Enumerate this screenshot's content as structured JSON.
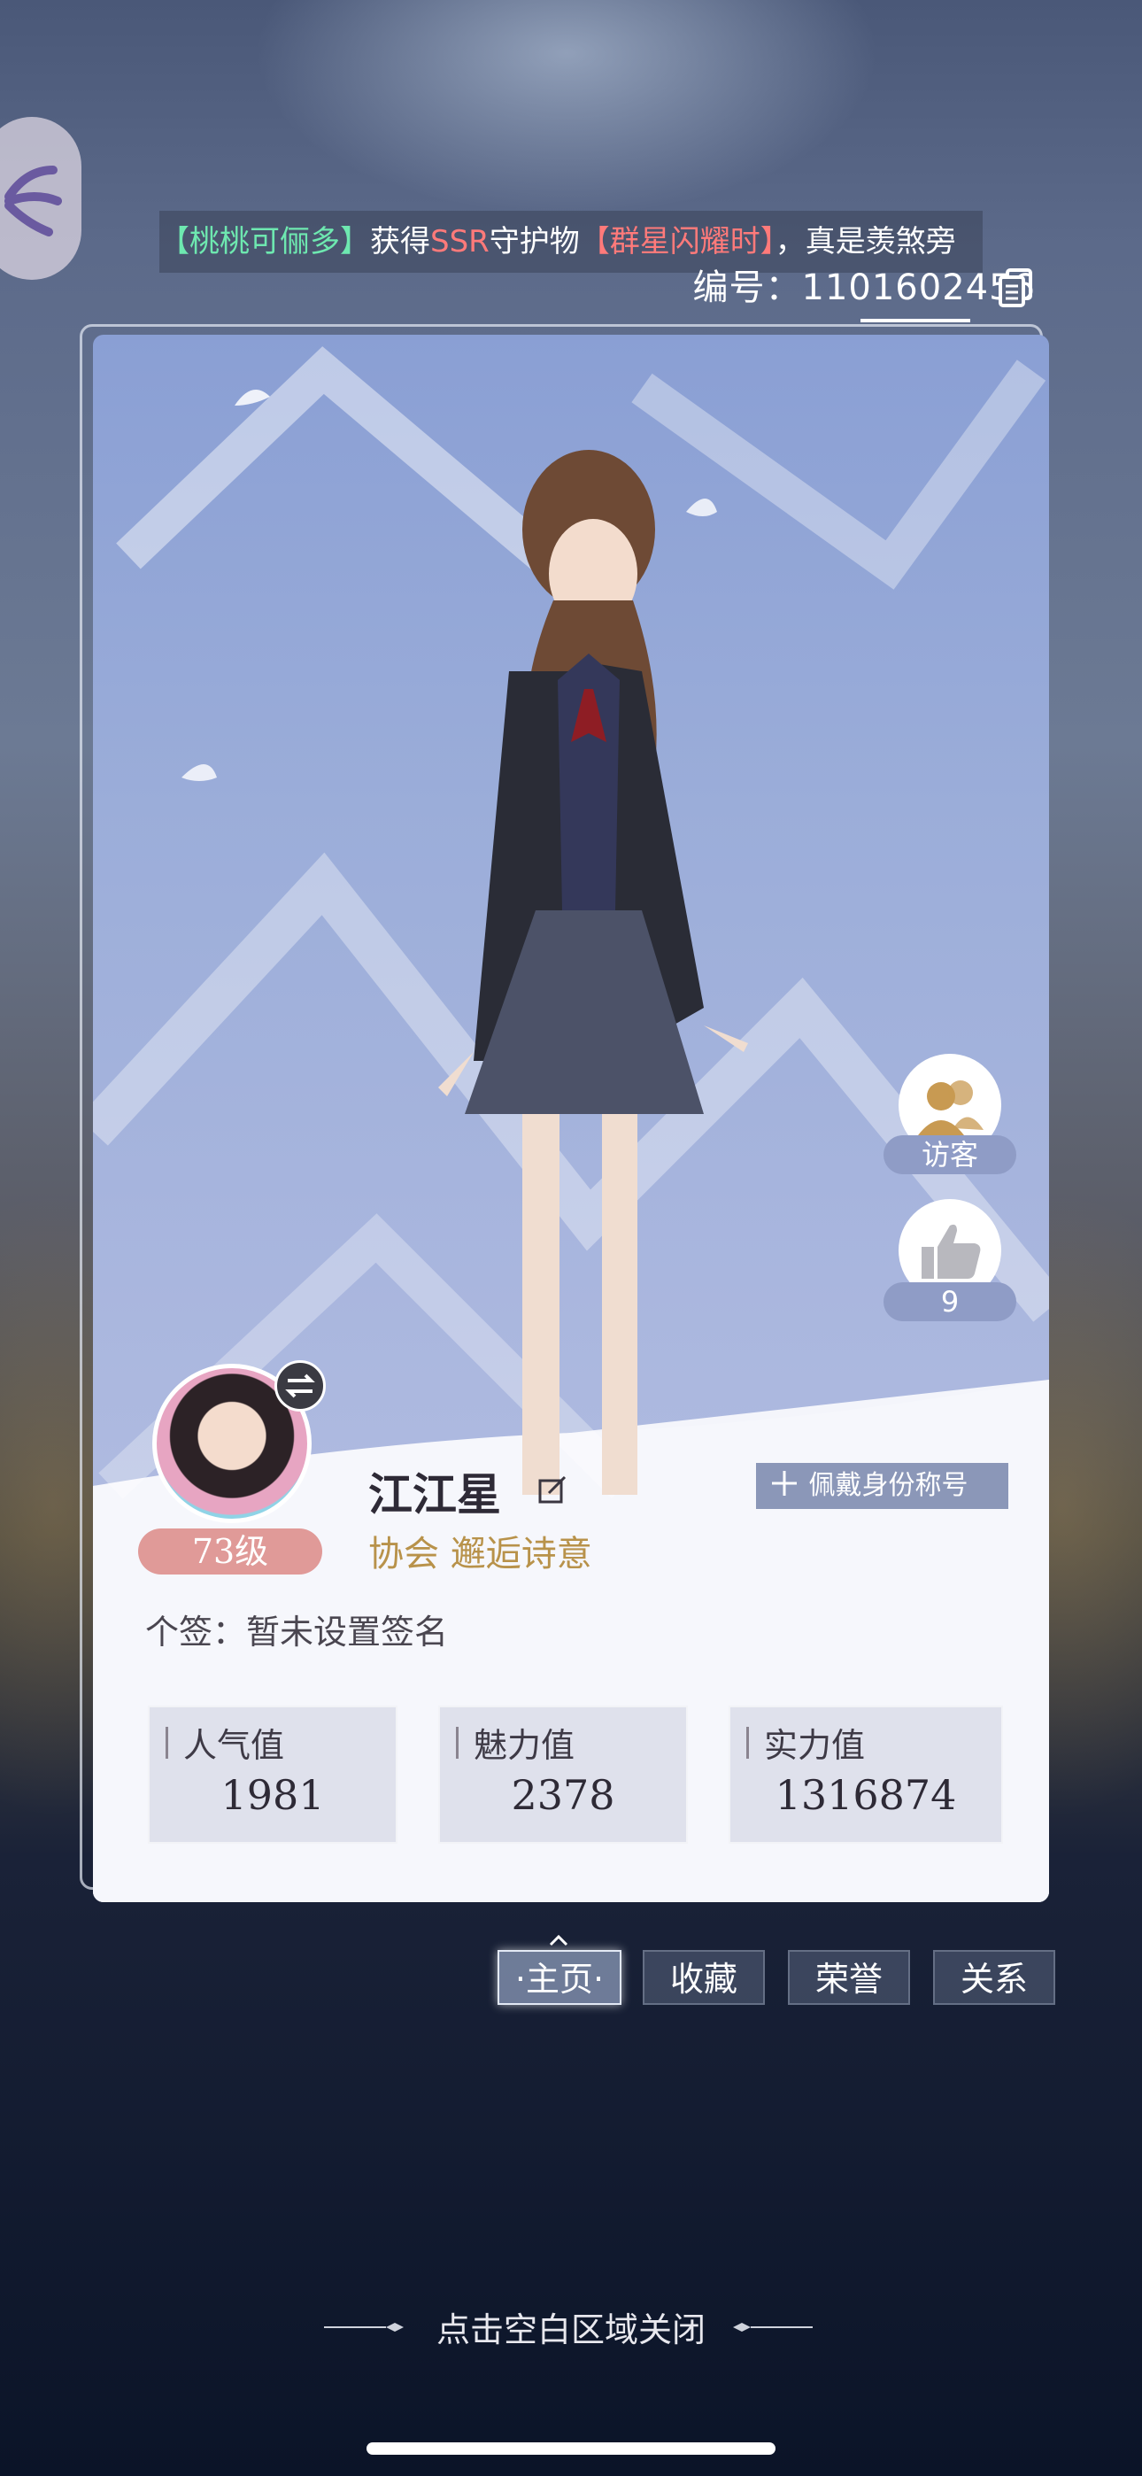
{
  "ticker": {
    "part1": "【桃桃可俪多】",
    "part2": "获得",
    "part3": "SSR",
    "part4": "守护物",
    "part5": "【群星闪耀时】",
    "part6": "，真是羡煞旁"
  },
  "profile": {
    "id_label": "编号：",
    "id_value": "1101602456",
    "name": "江江星",
    "level": "73级",
    "guild_label": "协会",
    "guild_name": "邂逅诗意",
    "title_button": "佩戴身份称号",
    "signature": "个签：暂未设置签名"
  },
  "stats": [
    {
      "label": "人气值",
      "value": "1981"
    },
    {
      "label": "魅力值",
      "value": "2378"
    },
    {
      "label": "实力值",
      "value": "1316874"
    }
  ],
  "side": {
    "visitors_label": "访客",
    "likes_count": "9"
  },
  "tabs": [
    {
      "label": "·主页·",
      "active": true
    },
    {
      "label": "收藏",
      "active": false
    },
    {
      "label": "荣誉",
      "active": false
    },
    {
      "label": "关系",
      "active": false
    }
  ],
  "close_hint": "点击空白区域关闭",
  "colors": {
    "accent_gold": "#b8924a",
    "level_badge": "#e09a98",
    "ticker_green": "#6ee8b0",
    "ticker_red": "#ff7a7a"
  }
}
